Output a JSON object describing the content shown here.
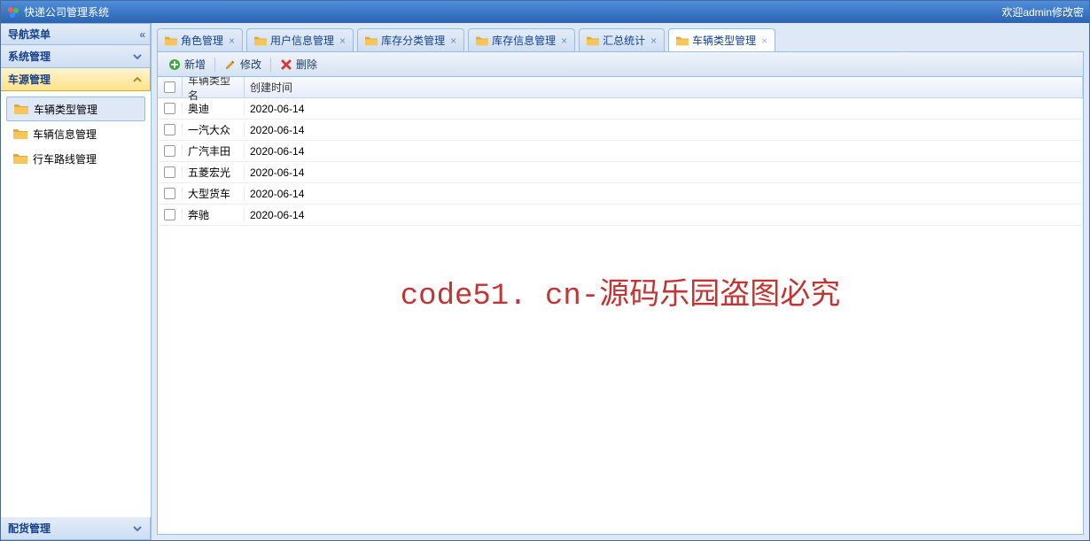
{
  "app": {
    "title": "快递公司管理系统",
    "welcome": "欢迎admin修改密"
  },
  "sidebar": {
    "title": "导航菜单",
    "sections": {
      "sys": {
        "label": "系统管理"
      },
      "vehicle": {
        "label": "车源管理"
      },
      "dispatch": {
        "label": "配货管理"
      }
    },
    "tree": [
      {
        "label": "车辆类型管理",
        "selected": true
      },
      {
        "label": "车辆信息管理",
        "selected": false
      },
      {
        "label": "行车路线管理",
        "selected": false
      }
    ]
  },
  "tabs": [
    {
      "label": "角色管理",
      "active": false
    },
    {
      "label": "用户信息管理",
      "active": false
    },
    {
      "label": "库存分类管理",
      "active": false
    },
    {
      "label": "库存信息管理",
      "active": false
    },
    {
      "label": "汇总统计",
      "active": false
    },
    {
      "label": "车辆类型管理",
      "active": true
    }
  ],
  "toolbar": {
    "add": "新增",
    "edit": "修改",
    "delete": "删除"
  },
  "grid": {
    "columns": {
      "name": "车辆类型名",
      "date": "创建时间"
    },
    "rows": [
      {
        "name": "奥迪",
        "date": "2020-06-14"
      },
      {
        "name": "一汽大众",
        "date": "2020-06-14"
      },
      {
        "name": "广汽丰田",
        "date": "2020-06-14"
      },
      {
        "name": "五菱宏光",
        "date": "2020-06-14"
      },
      {
        "name": "大型货车",
        "date": "2020-06-14"
      },
      {
        "name": "奔驰",
        "date": "2020-06-14"
      }
    ]
  },
  "watermark": "code51. cn-源码乐园盗图必究"
}
